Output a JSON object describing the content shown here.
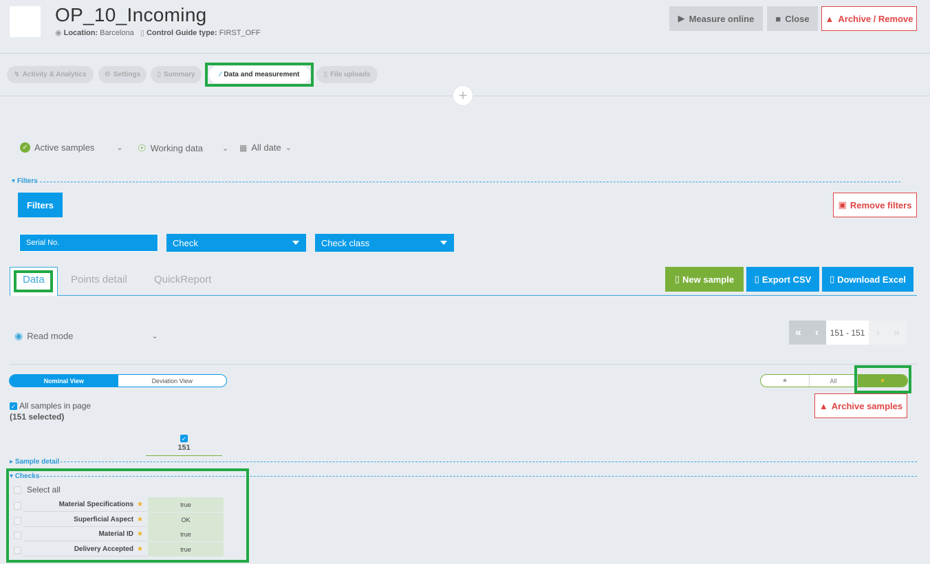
{
  "header": {
    "title": "OP_10_Incoming",
    "location_label": "Location:",
    "location_value": "Barcelona",
    "control_label": "Control Guide type:",
    "control_value": "FIRST_OFF",
    "measure_label": "Measure online",
    "close_label": "Close",
    "archive_label": "Archive / Remove"
  },
  "top_tabs": [
    {
      "label": "Activity & Analytics"
    },
    {
      "label": "Settings"
    },
    {
      "label": "Summary"
    },
    {
      "label": "Data and measurement"
    },
    {
      "label": "File uploads"
    }
  ],
  "toolbar": {
    "samples": "Active samples",
    "working": "Working data",
    "date": "All date"
  },
  "filters": {
    "section_label": "Filters",
    "button": "Filters",
    "remove": "Remove filters",
    "serial_placeholder": "Serial No.",
    "check": "Check",
    "check_class": "Check class"
  },
  "data_tabs": [
    {
      "label": "Data"
    },
    {
      "label": "Points detail"
    },
    {
      "label": "QuickReport"
    }
  ],
  "actions": {
    "new_sample": "New sample",
    "export_csv": "Export CSV",
    "download_excel": "Download Excel"
  },
  "read_mode": "Read mode",
  "pager": {
    "range": "151 - 151"
  },
  "view_toggle": {
    "nominal": "Nominal View",
    "deviation": "Deviation View"
  },
  "star_toggle": {
    "all": "All"
  },
  "archive_samples": "Archive samples",
  "samples": {
    "all_in_page": "All samples in page",
    "selected": "(151 selected)",
    "column_id": "151"
  },
  "sections": {
    "sample_detail": "Sample detail",
    "checks": "Checks"
  },
  "checks": {
    "select_all": "Select all",
    "rows": [
      {
        "name": "Material Specifications",
        "value": "true"
      },
      {
        "name": "Superficial Aspect",
        "value": "OK"
      },
      {
        "name": "Material ID",
        "value": "true"
      },
      {
        "name": "Delivery Accepted",
        "value": "true"
      }
    ]
  }
}
